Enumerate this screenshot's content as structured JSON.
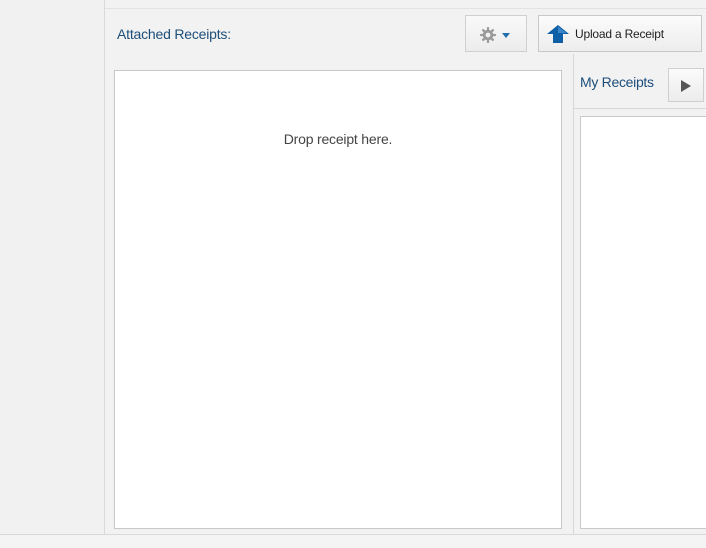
{
  "attachments": {
    "title": "Attached Receipts:",
    "drop_hint": "Drop receipt here."
  },
  "toolbar": {
    "gear_icon": "gear-icon",
    "dropdown_icon": "chevron-down-icon",
    "upload_icon": "up-arrow-icon",
    "upload_label": "Upload a Receipt"
  },
  "my_receipts": {
    "tab_label": "My Receipts",
    "expand_icon": "play-right-icon"
  },
  "colors": {
    "accent": "#1d6fb0",
    "title_text": "#1d4e7a",
    "upload_arrow": "#0f5fa6"
  }
}
